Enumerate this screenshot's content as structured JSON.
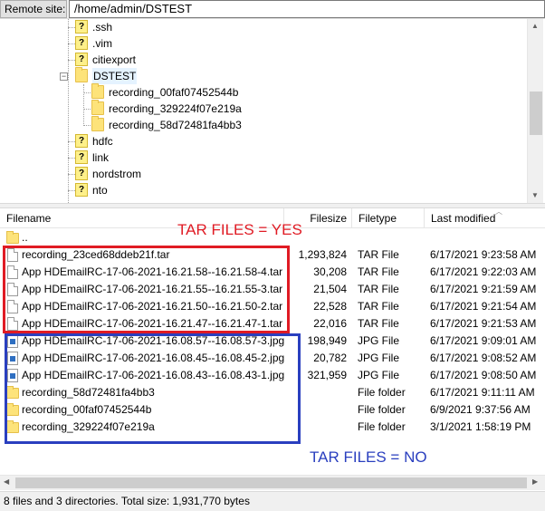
{
  "site_bar": {
    "label": "Remote site:",
    "path": "/home/admin/DSTEST"
  },
  "tree": {
    "items": [
      {
        "label": ".ssh",
        "icon": "question-folder-icon"
      },
      {
        "label": ".vim",
        "icon": "question-folder-icon"
      },
      {
        "label": "citiexport",
        "icon": "question-folder-icon"
      },
      {
        "label": "DSTEST",
        "icon": "folder-icon",
        "expanded": true,
        "selected": true
      },
      {
        "label": "recording_00faf07452544b",
        "icon": "folder-icon"
      },
      {
        "label": "recording_329224f07e219a",
        "icon": "folder-icon"
      },
      {
        "label": "recording_58d72481fa4bb3",
        "icon": "folder-icon"
      },
      {
        "label": "hdfc",
        "icon": "question-folder-icon"
      },
      {
        "label": "link",
        "icon": "question-folder-icon"
      },
      {
        "label": "nordstrom",
        "icon": "question-folder-icon"
      },
      {
        "label": "nto",
        "icon": "question-folder-icon"
      }
    ],
    "expander_symbol": "−"
  },
  "list": {
    "headers": {
      "name": "Filename",
      "size": "Filesize",
      "type": "Filetype",
      "modified": "Last modified"
    },
    "rows": [
      {
        "name": "..",
        "size": "",
        "type": "",
        "modified": "",
        "icon": "folder-icon"
      },
      {
        "name": "recording_23ced68ddeb21f.tar",
        "size": "1,293,824",
        "type": "TAR File",
        "modified": "6/17/2021 9:23:58 AM",
        "icon": "file-icon"
      },
      {
        "name": "App HDEmailRC-17-06-2021-16.21.58--16.21.58-4.tar",
        "size": "30,208",
        "type": "TAR File",
        "modified": "6/17/2021 9:22:03 AM",
        "icon": "file-icon"
      },
      {
        "name": "App HDEmailRC-17-06-2021-16.21.55--16.21.55-3.tar",
        "size": "21,504",
        "type": "TAR File",
        "modified": "6/17/2021 9:21:59 AM",
        "icon": "file-icon"
      },
      {
        "name": "App HDEmailRC-17-06-2021-16.21.50--16.21.50-2.tar",
        "size": "22,528",
        "type": "TAR File",
        "modified": "6/17/2021 9:21:54 AM",
        "icon": "file-icon"
      },
      {
        "name": "App HDEmailRC-17-06-2021-16.21.47--16.21.47-1.tar",
        "size": "22,016",
        "type": "TAR File",
        "modified": "6/17/2021 9:21:53 AM",
        "icon": "file-icon"
      },
      {
        "name": "App HDEmailRC-17-06-2021-16.08.57--16.08.57-3.jpg",
        "size": "198,949",
        "type": "JPG File",
        "modified": "6/17/2021 9:09:01 AM",
        "icon": "image-file-icon"
      },
      {
        "name": "App HDEmailRC-17-06-2021-16.08.45--16.08.45-2.jpg",
        "size": "20,782",
        "type": "JPG File",
        "modified": "6/17/2021 9:08:52 AM",
        "icon": "image-file-icon"
      },
      {
        "name": "App HDEmailRC-17-06-2021-16.08.43--16.08.43-1.jpg",
        "size": "321,959",
        "type": "JPG File",
        "modified": "6/17/2021 9:08:50 AM",
        "icon": "image-file-icon"
      },
      {
        "name": "recording_58d72481fa4bb3",
        "size": "",
        "type": "File folder",
        "modified": "6/17/2021 9:11:11 AM",
        "icon": "folder-icon"
      },
      {
        "name": "recording_00faf07452544b",
        "size": "",
        "type": "File folder",
        "modified": "6/9/2021 9:37:56 AM",
        "icon": "folder-icon"
      },
      {
        "name": "recording_329224f07e219a",
        "size": "",
        "type": "File folder",
        "modified": "3/1/2021 1:58:19 PM",
        "icon": "folder-icon"
      }
    ]
  },
  "annotations": {
    "red_text": "TAR FILES = YES",
    "blue_text": "TAR FILES = NO",
    "red_color": "#e01b24",
    "blue_color": "#2a3fbf"
  },
  "status": {
    "text": "8 files and 3 directories. Total size: 1,931,770 bytes"
  },
  "icons": {
    "question_mark": "?",
    "scroll_up": "▲",
    "scroll_down": "▼",
    "scroll_left": "◀",
    "scroll_right": "▶",
    "sort": "︿"
  }
}
